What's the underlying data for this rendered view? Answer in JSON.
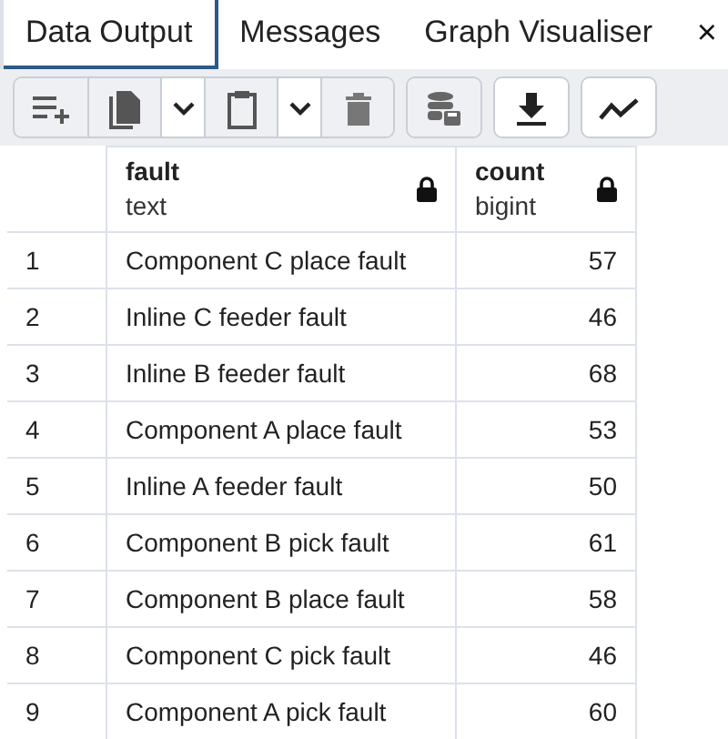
{
  "tabs": [
    {
      "label": "Data Output",
      "selected": true
    },
    {
      "label": "Messages",
      "selected": false
    },
    {
      "label": "Graph Visualiser",
      "selected": false
    }
  ],
  "close_glyph": "×",
  "toolbar": [
    {
      "buttons": [
        {
          "kind": "add-row"
        },
        {
          "kind": "copy"
        },
        {
          "kind": "caret"
        },
        {
          "kind": "paste"
        },
        {
          "kind": "caret"
        },
        {
          "kind": "delete"
        }
      ]
    },
    {
      "buttons": [
        {
          "kind": "save-data"
        }
      ]
    },
    {
      "buttons": [
        {
          "kind": "download"
        }
      ]
    },
    {
      "buttons": [
        {
          "kind": "graph"
        }
      ]
    }
  ],
  "table": {
    "columns": [
      {
        "name": "fault",
        "type": "text"
      },
      {
        "name": "count",
        "type": "bigint"
      }
    ],
    "rows": [
      {
        "number": "1",
        "cells": [
          "Component C place fault",
          "57"
        ]
      },
      {
        "number": "2",
        "cells": [
          "Inline C feeder fault",
          "46"
        ]
      },
      {
        "number": "3",
        "cells": [
          "Inline B feeder fault",
          "68"
        ]
      },
      {
        "number": "4",
        "cells": [
          "Component A place fault",
          "53"
        ]
      },
      {
        "number": "5",
        "cells": [
          "Inline A feeder fault",
          "50"
        ]
      },
      {
        "number": "6",
        "cells": [
          "Component B pick fault",
          "61"
        ]
      },
      {
        "number": "7",
        "cells": [
          "Component B place fault",
          "58"
        ]
      },
      {
        "number": "8",
        "cells": [
          "Component C pick fault",
          "46"
        ]
      },
      {
        "number": "9",
        "cells": [
          "Component A pick fault",
          "60"
        ]
      }
    ]
  }
}
